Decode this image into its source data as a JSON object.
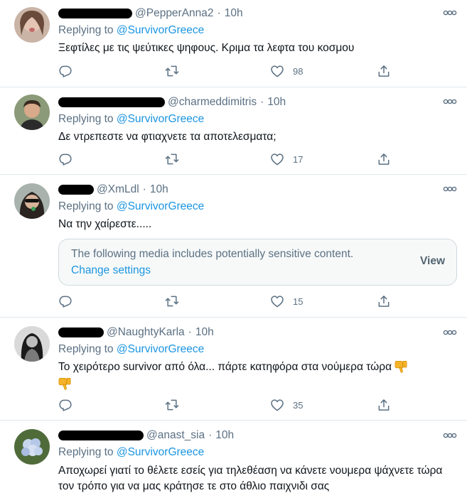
{
  "replying_prefix": "Replying to",
  "tweets": [
    {
      "handle": "@PepperAnna2",
      "time": "10h",
      "replying_to": "@SurvivorGreece",
      "text": "Ξεφτίλες με τις ψεύτικες ψηφους. Κριμα τα λεφτα του κοσμου",
      "likes": "98"
    },
    {
      "handle": "@charmeddimitris",
      "time": "10h",
      "replying_to": "@SurvivorGreece",
      "text": "Δε ντρεπεστε να φτιαχνετε τα αποτελεσματα;",
      "likes": "17"
    },
    {
      "handle": "@XmLdl",
      "time": "10h",
      "replying_to": "@SurvivorGreece",
      "text": "Να την χαίρεστε.....",
      "likes": "15",
      "media_warning": {
        "text": "The following media includes potentially sensitive content.",
        "link": "Change settings",
        "button": "View"
      }
    },
    {
      "handle": "@NaughtyKarla",
      "time": "10h",
      "replying_to": "@SurvivorGreece",
      "text": "Το χειρότερο survivor από όλα... πάρτε κατηφόρα στα νούμερα τώρα",
      "likes": "35"
    },
    {
      "handle": "@anast_sia",
      "time": "10h",
      "replying_to": "@SurvivorGreece",
      "text": "Αποχωρεί γιατί το θέλετε εσείς για τηλεθέαση να κάνετε νουμερα ψάχνετε τώρα τον τρόπο για να μας κράτησε τε στο άθλιο παιχνιδι σας"
    }
  ],
  "colors": {
    "accent": "#1b95e0",
    "secondary_text": "#5b7083",
    "divider": "#e1e8ed"
  }
}
